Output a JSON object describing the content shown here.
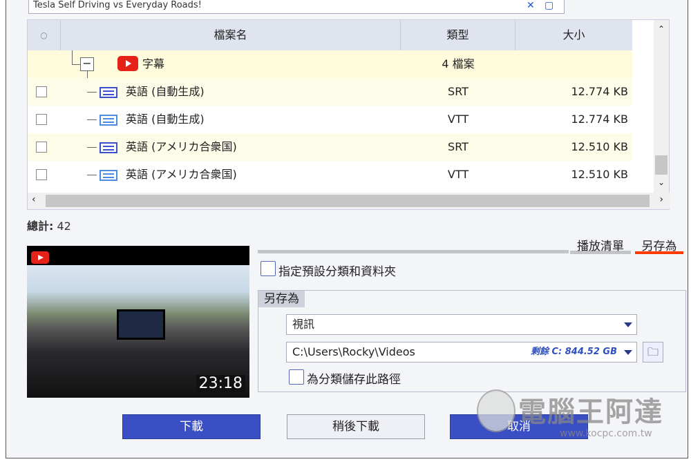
{
  "video_title": "Tesla Self Driving vs Everyday Roads!",
  "table": {
    "columns": [
      "○",
      "檔案名",
      "類型",
      "大小"
    ],
    "group": {
      "name": "字幕",
      "type": "4 檔案"
    },
    "rows": [
      {
        "name": "英語 (自動生成)",
        "type": "SRT",
        "size": "12.774 KB"
      },
      {
        "name": "英語 (自動生成)",
        "type": "VTT",
        "size": "12.774 KB"
      },
      {
        "name": "英語 (アメリカ合衆国)",
        "type": "SRT",
        "size": "12.510 KB"
      },
      {
        "name": "英語 (アメリカ合衆国)",
        "type": "VTT",
        "size": "12.510 KB"
      }
    ]
  },
  "total_label": "總計:",
  "total_value": "42",
  "duration": "23:18",
  "tabs": [
    "播放清單",
    "另存為"
  ],
  "default_folder_label": "指定預設分類和資料夾",
  "save_as": {
    "title": "另存為",
    "category": "視訊",
    "path": "C:\\Users\\Rocky\\Videos",
    "free_space": "剩餘 C: 844.52 GB",
    "save_path_label": "為分類儲存此路徑"
  },
  "buttons": {
    "download": "下載",
    "later": "稍後下載",
    "cancel": "取消"
  },
  "watermark": {
    "name": "電腦王阿達",
    "url": "www.kocpc.com.tw"
  },
  "colors": {
    "accent": "#3b4fc4",
    "tab_active": "#ff3b00"
  }
}
